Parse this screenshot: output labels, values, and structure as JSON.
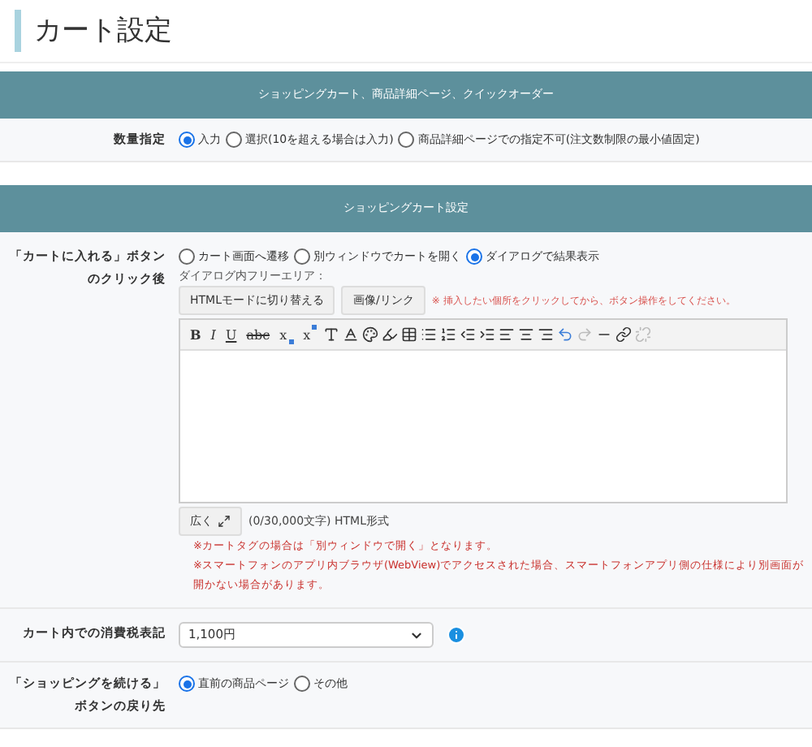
{
  "page_title": "カート設定",
  "sections": [
    {
      "header": "ショッピングカート、商品詳細ページ、クイックオーダー",
      "rows": [
        {
          "kind": "radio",
          "label": "数量指定",
          "options": [
            {
              "label": "入力",
              "selected": true
            },
            {
              "label": "選択(10を超える場合は入力)",
              "selected": false
            },
            {
              "label": "商品詳細ページでの指定不可(注文数制限の最小値固定)",
              "selected": false
            }
          ]
        }
      ]
    },
    {
      "header": "ショッピングカート設定",
      "rows": [
        {
          "kind": "editor",
          "label": "「カートに入れる」ボタンのクリック後",
          "options": [
            {
              "label": "カート画面へ遷移",
              "selected": false
            },
            {
              "label": "別ウィンドウでカートを開く",
              "selected": false
            },
            {
              "label": "ダイアログで結果表示",
              "selected": true
            }
          ],
          "editor_label": "ダイアログ内フリーエリア：",
          "mode_buttons": [
            "HTMLモードに切り替える",
            "画像/リンク"
          ],
          "hint": "※ 挿入したい個所をクリックしてから、ボタン操作をしてください。",
          "format_buttons": [
            {
              "kind": "bold",
              "label": "B"
            },
            {
              "kind": "italic",
              "label": "I"
            },
            {
              "kind": "underline",
              "label": "U"
            },
            {
              "kind": "strike",
              "label": "abc"
            },
            {
              "kind": "sub",
              "label": "x"
            },
            {
              "kind": "sup",
              "label": "x"
            }
          ],
          "expand_button": "広く",
          "counter": "(0/30,000文字) HTML形式",
          "notes": [
            "※カートタグの場合は「別ウィンドウで開く」となります。",
            "※スマートフォンのアプリ内ブラウザ(WebView)でアクセスされた場合、スマートフォンアプリ側の仕様により別画面が開かない場合があります。"
          ]
        },
        {
          "kind": "select",
          "label": "カート内での消費税表記",
          "value": "1,100円"
        },
        {
          "kind": "radio",
          "label": "「ショッピングを続ける」ボタンの戻り先",
          "options": [
            {
              "label": "直前の商品ページ",
              "selected": true
            },
            {
              "label": "その他",
              "selected": false
            }
          ]
        }
      ]
    }
  ]
}
